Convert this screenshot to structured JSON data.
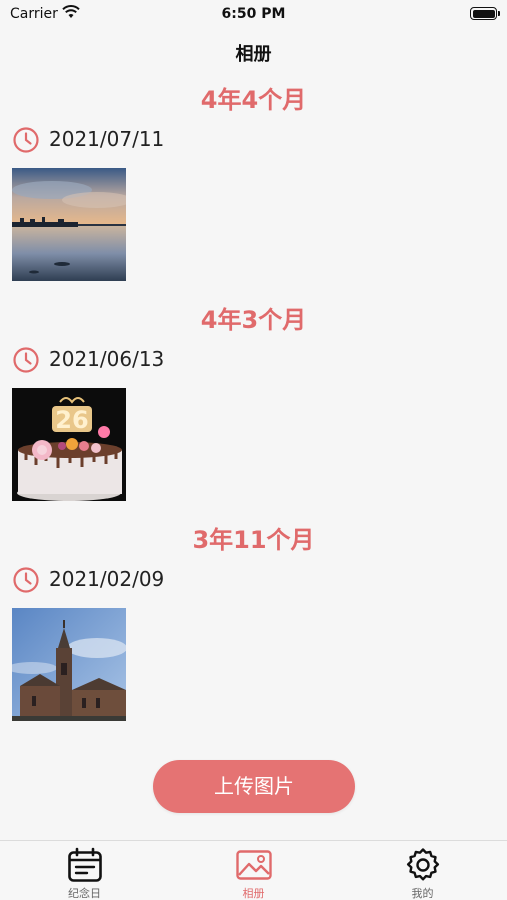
{
  "status_bar": {
    "carrier": "Carrier",
    "time": "6:50 PM"
  },
  "nav": {
    "title": "相册"
  },
  "entries": [
    {
      "duration": "4年4个月",
      "date": "2021/07/11",
      "photo": "sunset-lake-photo"
    },
    {
      "duration": "4年3个月",
      "date": "2021/06/13",
      "photo": "birthday-cake-photo"
    },
    {
      "duration": "3年11个月",
      "date": "2021/02/09",
      "photo": "church-tower-photo"
    }
  ],
  "upload_button": {
    "label": "上传图片"
  },
  "tabs": [
    {
      "label": "纪念日",
      "icon": "calendar-icon",
      "active": false
    },
    {
      "label": "相册",
      "icon": "photo-album-icon",
      "active": true
    },
    {
      "label": "我的",
      "icon": "settings-gear-icon",
      "active": false
    }
  ],
  "colors": {
    "accent": "#e06a6b",
    "button": "#e57373",
    "background": "#f6f6f6"
  }
}
